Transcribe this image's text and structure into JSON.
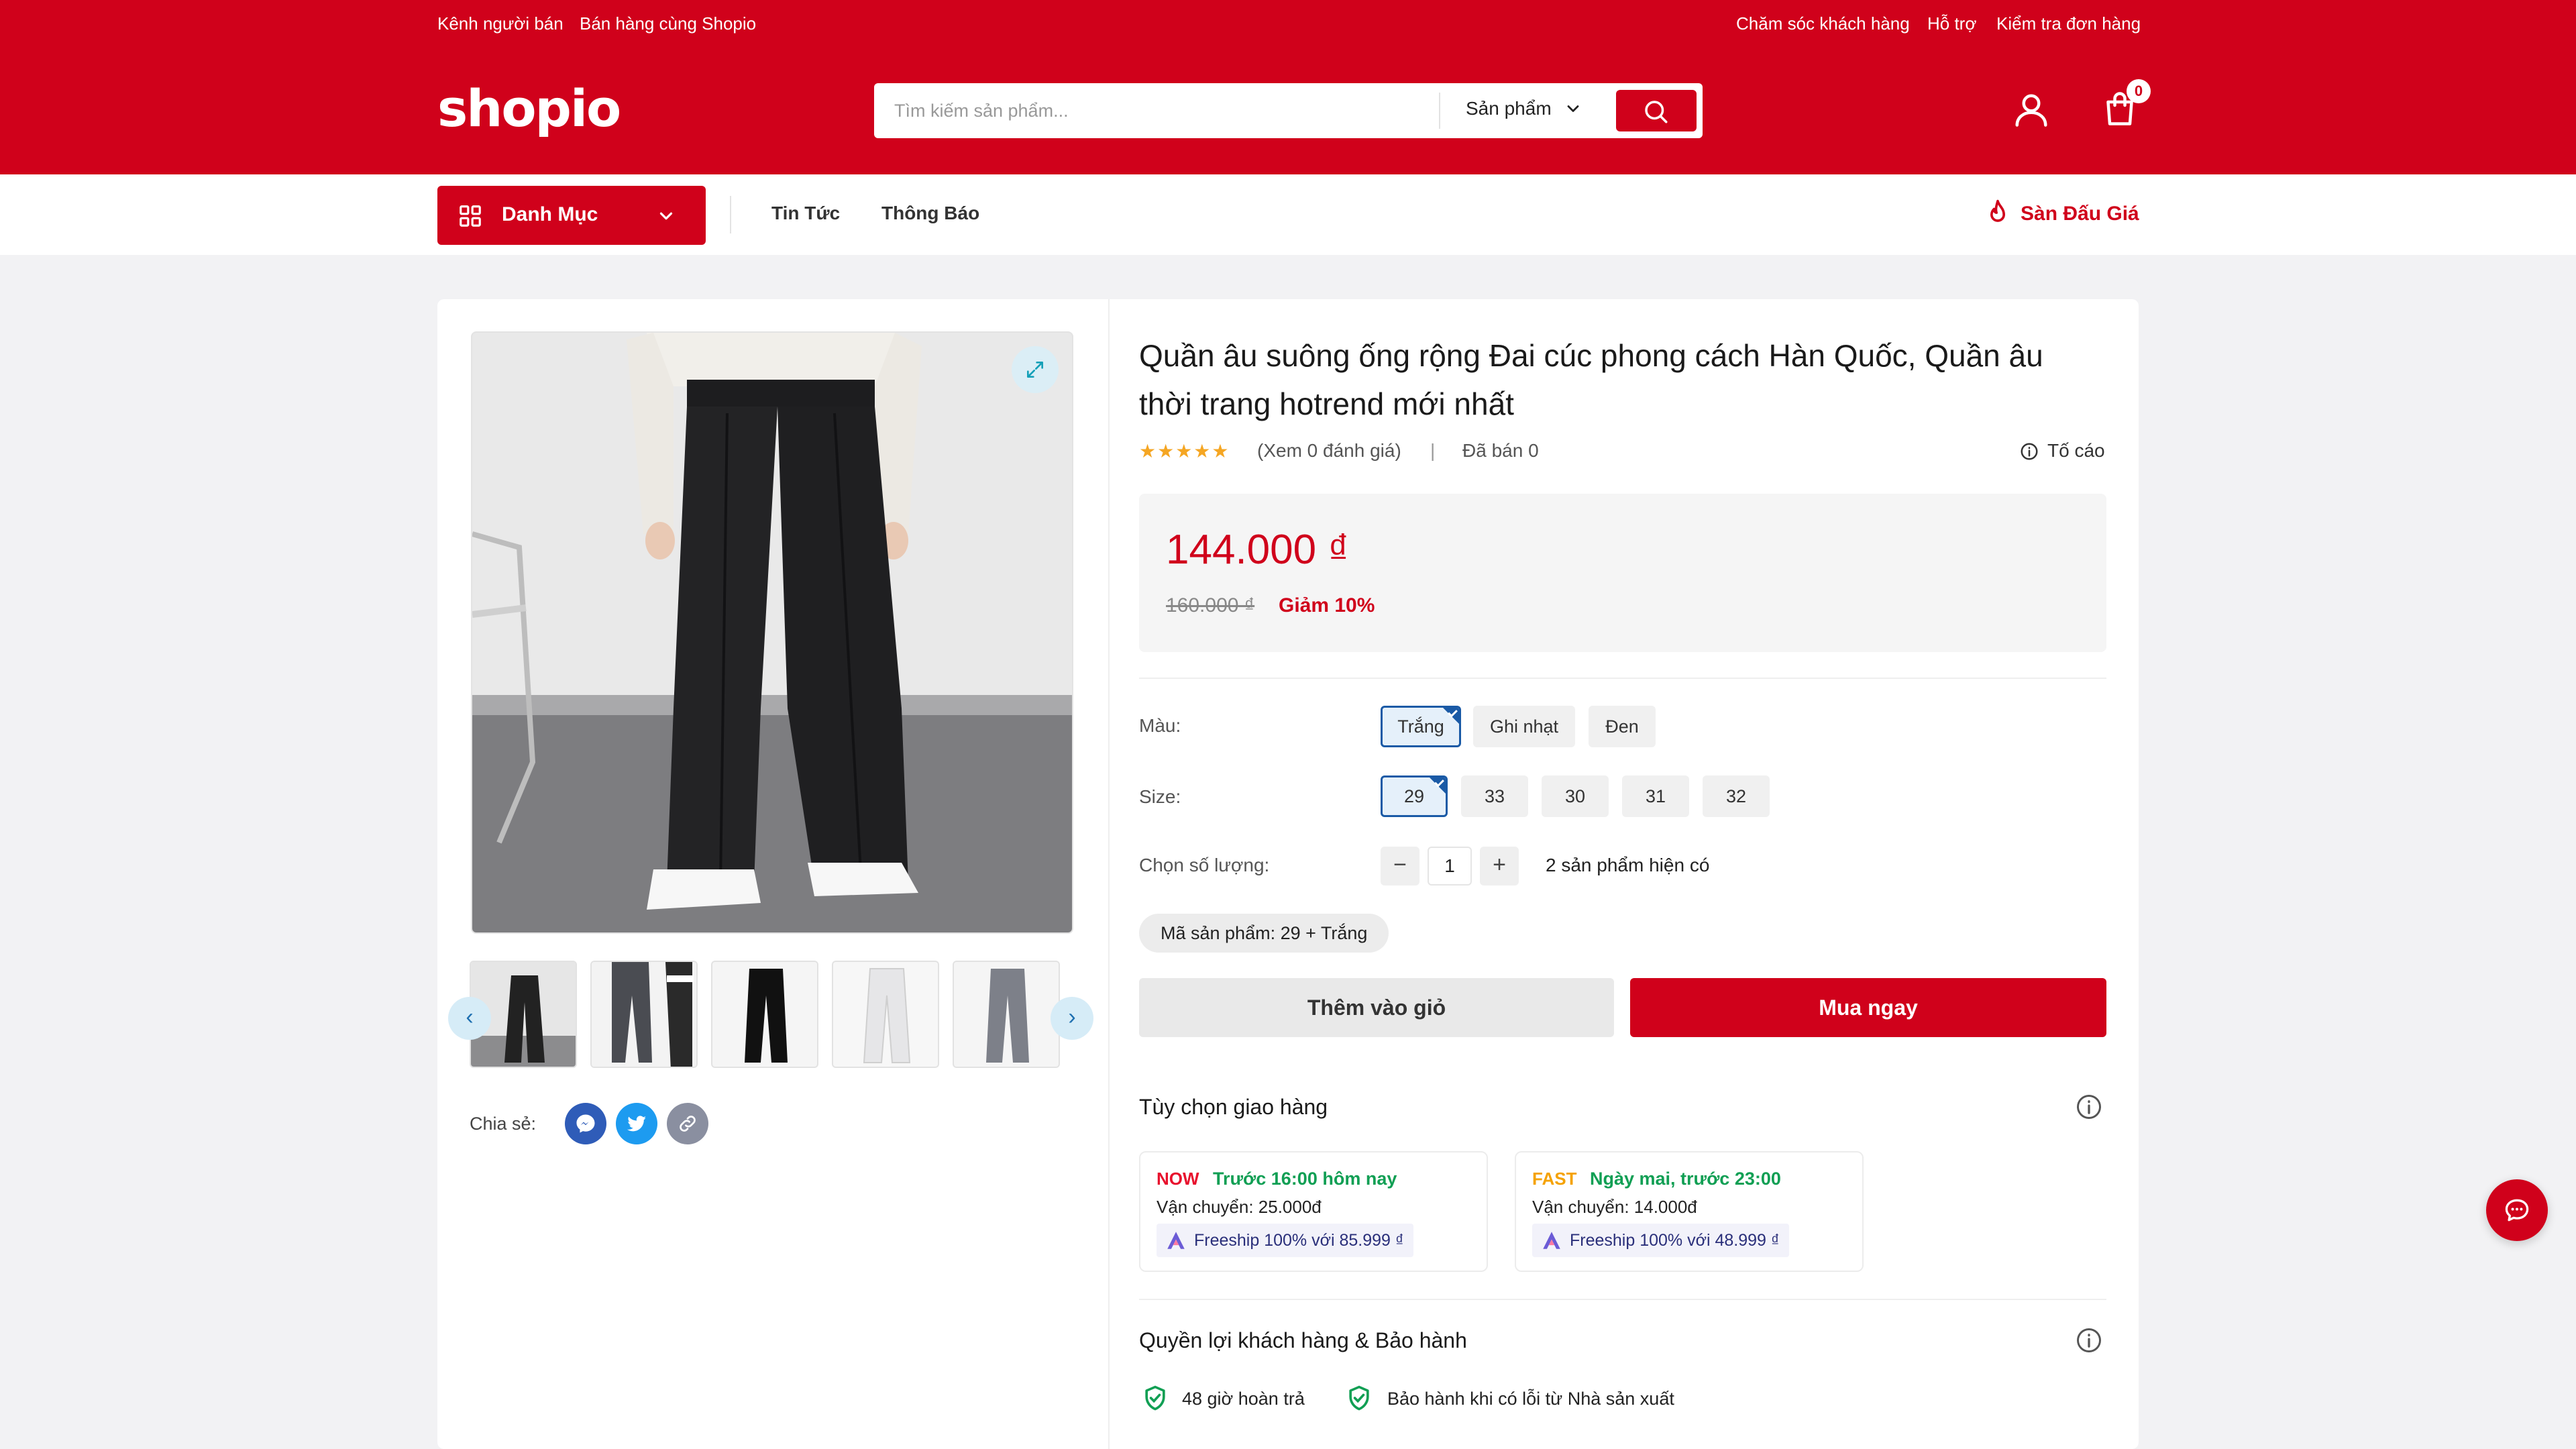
{
  "topbar": {
    "seller_channel": "Kênh người bán",
    "sell_with": "Bán hàng cùng Shopio",
    "customer_care": "Chăm sóc khách hàng",
    "support": "Hỗ trợ",
    "check_order": "Kiểm tra đơn hàng"
  },
  "header": {
    "logo": "shopio",
    "search_placeholder": "Tìm kiếm sản phẩm...",
    "search_category": "Sản phẩm",
    "cart_count": "0"
  },
  "nav": {
    "category_button": "Danh Mục",
    "links": [
      "Tin Tức",
      "Thông Báo"
    ],
    "auction": "Sàn Đấu Giá"
  },
  "product": {
    "title": "Quần âu suông ống rộng Đai cúc phong cách Hàn Quốc, Quần âu thời trang hotrend mới nhất",
    "rating_stars": 5,
    "reviews_text": "(Xem 0 đánh giá)",
    "sold_text": "Đã bán 0",
    "report": "Tố cáo",
    "price": "144.000 ₫",
    "old_price": "160.000 ₫",
    "discount": "Giảm 10%",
    "color_label": "Màu:",
    "colors": [
      "Trắng",
      "Ghi nhạt",
      "Đen"
    ],
    "selected_color": "Trắng",
    "size_label": "Size:",
    "sizes": [
      "29",
      "33",
      "30",
      "31",
      "32"
    ],
    "selected_size": "29",
    "quantity_label": "Chọn số lượng:",
    "quantity": "1",
    "stock_text": "2 sản phẩm hiện có",
    "sku": "Mã sản phẩm: 29 + Trắng",
    "add_to_cart": "Thêm vào giỏ",
    "buy_now": "Mua ngay",
    "share_label": "Chia sẻ:"
  },
  "delivery": {
    "heading": "Tùy chọn giao hàng",
    "options": [
      {
        "tag": "NOW",
        "tag_color": "#e8112d",
        "when": "Trước 16:00 hôm nay",
        "fee": "Vận chuyển: 25.000đ",
        "freeship": "Freeship 100% với 85.999 ₫"
      },
      {
        "tag": "FAST",
        "tag_color": "#f5a200",
        "when": "Ngày mai, trước 23:00",
        "fee": "Vận chuyển: 14.000đ",
        "freeship": "Freeship 100% với 48.999 ₫"
      }
    ]
  },
  "warranty": {
    "heading": "Quyền lợi khách hàng & Bảo hành",
    "items": [
      "48 giờ hoàn trả",
      "Bảo hành khi có lỗi từ Nhà sản xuất"
    ]
  },
  "icons": {
    "search": "search-icon",
    "user": "user-icon",
    "cart": "cart-icon",
    "grid": "grid-icon",
    "fire": "fire-icon",
    "expand": "expand-icon",
    "info": "info-icon",
    "chat": "chat-icon"
  },
  "colors": {
    "brand": "#d0011b",
    "accent_blue": "#1a5aa6",
    "green": "#119f54"
  }
}
